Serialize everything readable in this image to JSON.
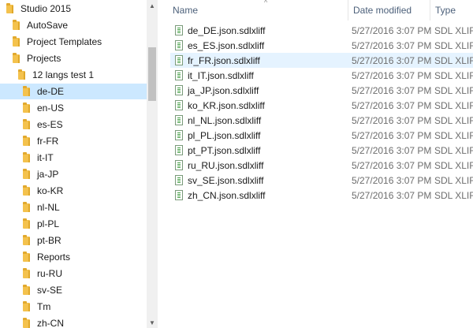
{
  "navigation": {
    "items": [
      {
        "label": "Studio 2015"
      },
      {
        "label": "AutoSave"
      },
      {
        "label": "Project Templates"
      },
      {
        "label": "Projects"
      },
      {
        "label": "12 langs test 1"
      },
      {
        "label": "de-DE",
        "selected": true
      },
      {
        "label": "en-US"
      },
      {
        "label": "es-ES"
      },
      {
        "label": "fr-FR"
      },
      {
        "label": "it-IT"
      },
      {
        "label": "ja-JP"
      },
      {
        "label": "ko-KR"
      },
      {
        "label": "nl-NL"
      },
      {
        "label": "pl-PL"
      },
      {
        "label": "pt-BR"
      },
      {
        "label": "Reports"
      },
      {
        "label": "ru-RU"
      },
      {
        "label": "sv-SE"
      },
      {
        "label": "Tm"
      },
      {
        "label": "zh-CN"
      }
    ]
  },
  "file_list": {
    "columns": {
      "name": "Name",
      "date": "Date modified",
      "type": "Type"
    },
    "sort_indicator": "^",
    "rows": [
      {
        "name": "de_DE.json.sdlxliff",
        "date": "5/27/2016 3:07 PM",
        "type": "SDL XLIFF F"
      },
      {
        "name": "es_ES.json.sdlxliff",
        "date": "5/27/2016 3:07 PM",
        "type": "SDL XLIFF F"
      },
      {
        "name": "fr_FR.json.sdlxliff",
        "date": "5/27/2016 3:07 PM",
        "type": "SDL XLIFF F",
        "hover": true
      },
      {
        "name": "it_IT.json.sdlxliff",
        "date": "5/27/2016 3:07 PM",
        "type": "SDL XLIFF F"
      },
      {
        "name": "ja_JP.json.sdlxliff",
        "date": "5/27/2016 3:07 PM",
        "type": "SDL XLIFF F"
      },
      {
        "name": "ko_KR.json.sdlxliff",
        "date": "5/27/2016 3:07 PM",
        "type": "SDL XLIFF F"
      },
      {
        "name": "nl_NL.json.sdlxliff",
        "date": "5/27/2016 3:07 PM",
        "type": "SDL XLIFF F"
      },
      {
        "name": "pl_PL.json.sdlxliff",
        "date": "5/27/2016 3:07 PM",
        "type": "SDL XLIFF F"
      },
      {
        "name": "pt_PT.json.sdlxliff",
        "date": "5/27/2016 3:07 PM",
        "type": "SDL XLIFF F"
      },
      {
        "name": "ru_RU.json.sdlxliff",
        "date": "5/27/2016 3:07 PM",
        "type": "SDL XLIFF F"
      },
      {
        "name": "sv_SE.json.sdlxliff",
        "date": "5/27/2016 3:07 PM",
        "type": "SDL XLIFF F"
      },
      {
        "name": "zh_CN.json.sdlxliff",
        "date": "5/27/2016 3:07 PM",
        "type": "SDL XLIFF F"
      }
    ]
  },
  "icons": {
    "folder": "folder-icon",
    "file": "sdlxliff-file-icon",
    "scroll_up": "scroll-up-arrow-icon",
    "scroll_down": "scroll-down-arrow-icon"
  },
  "colors": {
    "selection": "#cce8ff",
    "hover": "#e5f3ff",
    "folder": "#f4c24d",
    "header_text": "#4c607a"
  }
}
